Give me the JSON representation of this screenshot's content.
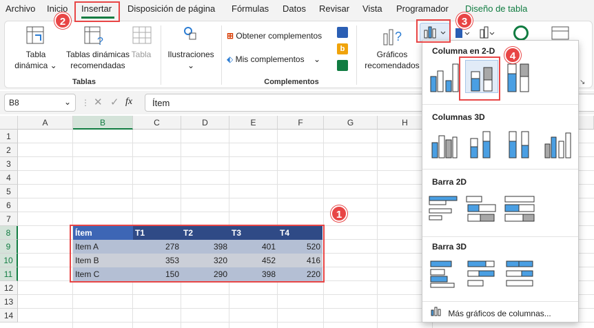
{
  "tabs": [
    "Archivo",
    "Inicio",
    "Insertar",
    "Disposición de página",
    "Fórmulas",
    "Datos",
    "Revisar",
    "Vista",
    "Programador",
    "Diseño de tabla"
  ],
  "ribbon": {
    "tabla_dinamica": [
      "Tabla",
      "dinámica"
    ],
    "tablas_recomendadas": [
      "Tablas dinámicas",
      "recomendadas"
    ],
    "tabla": "Tabla",
    "group_tablas": "Tablas",
    "ilustraciones": "Ilustraciones",
    "obtener": "Obtener complementos",
    "mis": "Mis complementos",
    "group_complementos": "Complementos",
    "graficos": [
      "Gráficos",
      "recomendados"
    ]
  },
  "formula_bar": {
    "name_box": "B8",
    "fx": "fx",
    "content": "Ítem"
  },
  "columns": [
    "A",
    "B",
    "C",
    "D",
    "E",
    "F",
    "G",
    "H"
  ],
  "rows": [
    "1",
    "2",
    "3",
    "4",
    "5",
    "6",
    "7",
    "8",
    "9",
    "10",
    "11",
    "12",
    "13",
    "14"
  ],
  "table": {
    "headers": [
      "Ítem",
      "T1",
      "T2",
      "T3",
      "T4"
    ],
    "rows": [
      {
        "item": "Item A",
        "values": [
          "278",
          "398",
          "401",
          "520"
        ]
      },
      {
        "item": "Item B",
        "values": [
          "353",
          "320",
          "452",
          "416"
        ]
      },
      {
        "item": "Item C",
        "values": [
          "150",
          "290",
          "398",
          "220"
        ]
      }
    ]
  },
  "dropdown": {
    "sec1": "Columna en 2-D",
    "sec2": "Columnas 3D",
    "sec3": "Barra 2D",
    "sec4": "Barra 3D",
    "more": "Más gráficos de columnas..."
  },
  "callouts": [
    "1",
    "2",
    "3",
    "4"
  ],
  "colors": {
    "accent": "#107c41",
    "callout": "#e84545",
    "chart_blue": "#4a9fe3",
    "table_header": "#2f4a86"
  }
}
